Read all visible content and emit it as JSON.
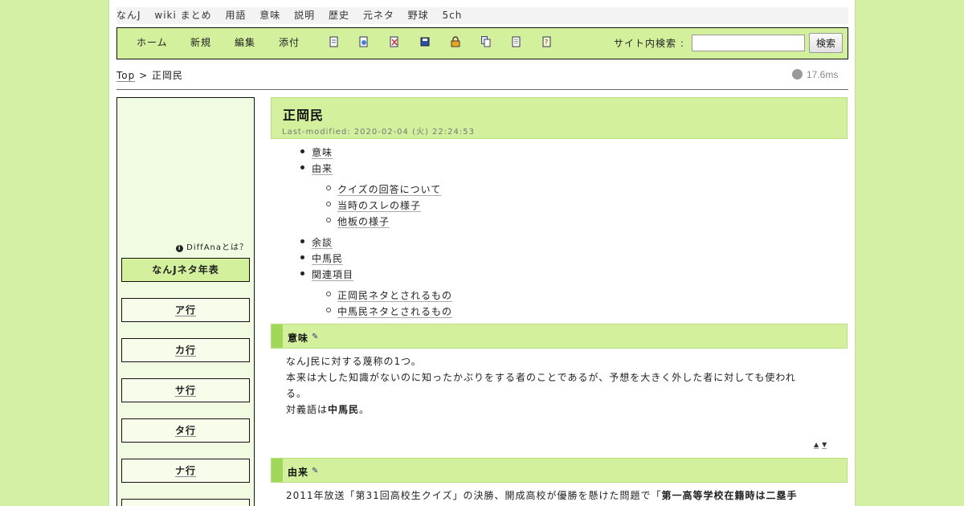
{
  "topbar": {
    "links": [
      "なんJ",
      "wiki まとめ",
      "用語",
      "意味",
      "説明",
      "歴史",
      "元ネタ",
      "野球",
      "5ch"
    ]
  },
  "navbar": {
    "links": [
      "ホーム",
      "新規",
      "編集",
      "添付"
    ],
    "icons": [
      "new-page-icon",
      "copy-page-icon",
      "diff-icon",
      "backup-icon",
      "freeze-icon",
      "list-icon",
      "recent-icon",
      "help-icon"
    ],
    "search_label": "サイト内検索 :",
    "search_value": "",
    "search_button": "検索"
  },
  "breadcrumb": {
    "top": "Top",
    "sep": ">",
    "current": "正岡民"
  },
  "timing": "17.6ms",
  "sidebar": {
    "diffana": "DiffAnaとは？",
    "header": "なんJネタ年表",
    "rows": [
      "ア行",
      "カ行",
      "サ行",
      "タ行",
      "ナ行",
      ""
    ]
  },
  "page": {
    "title": "正岡民",
    "modified": "Last-modified: 2020-02-04 (火) 22:24:53"
  },
  "toc": {
    "items": [
      "意味",
      "由来",
      "余談",
      "中馬民",
      "関連項目"
    ],
    "sub_origin": [
      "クイズの回答について",
      "当時のスレの様子",
      "他板の様子"
    ],
    "sub_related": [
      "正岡民ネタとされるもの",
      "中馬民ネタとされるもの"
    ]
  },
  "sections": {
    "meaning_title": "意味",
    "meaning_line1": "なんJ民に対する蔑称の1つ。",
    "meaning_line2": "本来は大した知識がないのに知ったかぶりをする者のことであるが、予想を大きく外した者に対しても使われ",
    "meaning_line3": "る。",
    "meaning_line4_pre": "対義語は",
    "meaning_line4_bold": "中馬民",
    "meaning_line4_post": "。",
    "arrows_up": "▲",
    "arrows_down": "▼",
    "origin_title": "由来",
    "origin_line1_pre": "2011年放送「第31回高校生クイズ」の決勝、開成高校が優勝を懸けた問題で「",
    "origin_line1_bold": "第一高等学校在籍時は二塁手"
  },
  "colors": {
    "background": "#d4f0a4",
    "accent": "#d3f09c",
    "accent_bar": "#9fd85a"
  }
}
